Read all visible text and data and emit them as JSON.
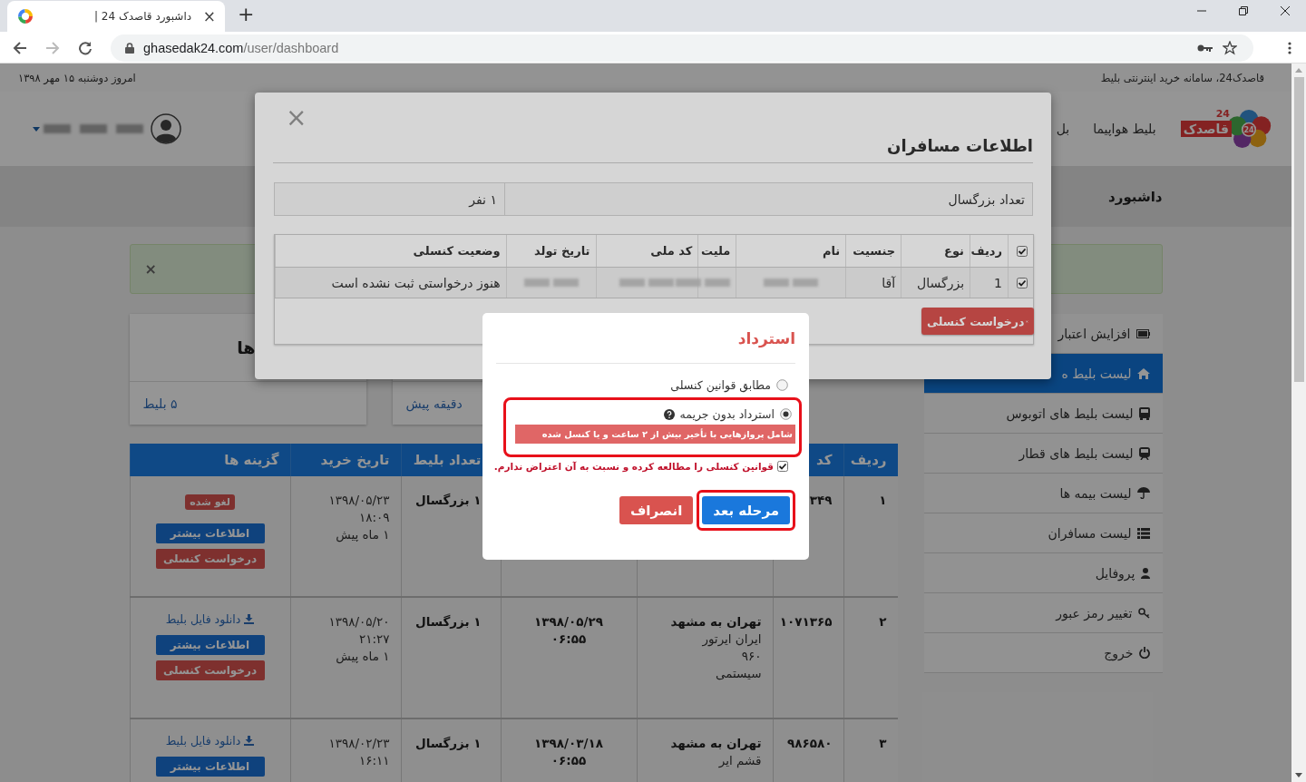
{
  "browser": {
    "tab": {
      "title": "داشبورد قاصدک 24 |",
      "close": "×"
    },
    "new_tab": "+",
    "address": {
      "host": "ghasedak24.com",
      "path": "/user/dashboard"
    }
  },
  "top_bar": {
    "tagline": "قاصدک24، سامانه خرید اینترنتی بلیط",
    "date": "امروز دوشنبه ۱۵ مهر ۱۳۹۸"
  },
  "header": {
    "logo": {
      "emblem": "24",
      "wordmark": "قاصدک",
      "badge": "24"
    },
    "nav": [
      {
        "label": "بلیط هواپیما"
      },
      {
        "label": "بل"
      }
    ]
  },
  "page_title": "داشبورد",
  "alert": {
    "close": "×"
  },
  "sidebar": {
    "items": [
      {
        "label": "افزایش اعتبار",
        "kind": "card",
        "selected": false
      },
      {
        "label": "لیست بلیط ه",
        "kind": "home",
        "selected": true
      },
      {
        "label": "لیست بلیط های اتوبوس",
        "kind": "bus",
        "selected": false
      },
      {
        "label": "لیست بلیط های قطار",
        "kind": "train",
        "selected": false
      },
      {
        "label": "لیست بیمه ها",
        "kind": "umbrella",
        "selected": false
      },
      {
        "label": "لیست مسافران",
        "kind": "list",
        "selected": false
      },
      {
        "label": "پروفایل",
        "kind": "user",
        "selected": false
      },
      {
        "label": "تغییر رمز عبور",
        "kind": "key",
        "selected": false
      },
      {
        "label": "خروج",
        "kind": "power",
        "selected": false
      }
    ]
  },
  "stat_cards": [
    {
      "link": "دقیقه پیش"
    },
    {
      "title": "ها",
      "link": "۵ بلیط"
    }
  ],
  "tickets_table": {
    "columns": [
      {
        "label": "ردیف"
      },
      {
        "label": "کد"
      },
      {},
      {},
      {
        "label": "تعداد بلیط"
      },
      {
        "label": "تاریخ خرید"
      },
      {
        "label": "گزینه ها"
      }
    ],
    "rows": [
      {
        "index": "۱",
        "code": "۳۴۹",
        "route": [],
        "departure": [],
        "count": "۱ بزرگسال",
        "purchase": [
          "۱۳۹۸/۰۵/۲۳",
          "۱۸:۰۹",
          "۱ ماه پیش"
        ],
        "options": [
          {
            "kind": "status",
            "label": "لغو شده"
          },
          {
            "kind": "info",
            "label": "اطلاعات بیشتر"
          },
          {
            "kind": "cancel",
            "label": "درخواست کنسلی"
          }
        ]
      },
      {
        "index": "۲",
        "code": "۱۰۷۱۳۶۵",
        "route": [
          "تهران به مشهد",
          "ایران ایرتور",
          "۹۶۰",
          "سیستمی"
        ],
        "departure": [
          "۱۳۹۸/۰۵/۲۹",
          "۰۶:۵۵"
        ],
        "count": "۱ بزرگسال",
        "purchase": [
          "۱۳۹۸/۰۵/۲۰",
          "۲۱:۲۷",
          "۱ ماه پیش"
        ],
        "options": [
          {
            "kind": "download",
            "label": "دانلود فایل بلیط"
          },
          {
            "kind": "info",
            "label": "اطلاعات بیشتر"
          },
          {
            "kind": "cancel",
            "label": "درخواست کنسلی"
          }
        ]
      },
      {
        "index": "۳",
        "code": "۹۸۶۵۸۰",
        "route": [
          "تهران به مشهد",
          "قشم ایر"
        ],
        "departure": [
          "۱۳۹۸/۰۳/۱۸",
          "۰۶:۵۵"
        ],
        "count": "۱ بزرگسال",
        "purchase": [
          "۱۳۹۸/۰۲/۲۳",
          "۱۶:۱۱"
        ],
        "options": [
          {
            "kind": "download",
            "label": "دانلود فایل بلیط"
          },
          {
            "kind": "info",
            "label": "اطلاعات بیشتر"
          }
        ]
      }
    ]
  },
  "passengers_modal": {
    "close": "×",
    "title": "اطلاعات مسافران",
    "summary": [
      {
        "label": "تعداد بزرگسال",
        "value": "۱ نفر"
      }
    ],
    "table": {
      "select_all": {
        "checked": true
      },
      "columns": [
        "ردیف",
        "نوع",
        "جنسیت",
        "نام",
        "ملیت",
        "کد ملی",
        "تاریخ تولد",
        "وضعیت کنسلی"
      ],
      "rows": [
        {
          "checked": true,
          "cells": [
            {
              "text": "1"
            },
            {
              "text": "بزرگسال"
            },
            {
              "text": "آقا"
            },
            {
              "kind": "redacted"
            },
            {
              "kind": "redacted"
            },
            {
              "kind": "redacted"
            },
            {
              "kind": "redacted"
            },
            {
              "text": "هنوز درخواستی ثبت نشده است"
            }
          ]
        }
      ]
    },
    "cancel_button": {
      "label": "درخواست کنسلی"
    }
  },
  "refund_dialog": {
    "title": "استرداد",
    "options": [
      {
        "label": "مطابق قوانین کنسلی",
        "selected": false,
        "help": false,
        "highlighted": false
      },
      {
        "label": "استرداد بدون جریمه",
        "selected": true,
        "help": true,
        "note": "شامل پروازهایی با تأخیر بیش از ۲ ساعت و یا کنسل شده",
        "highlighted": true
      }
    ],
    "agree": {
      "checked": true,
      "label": "قوانین کنسلی را مطالعه کرده و نسبت به آن اعتراض ندارم."
    },
    "buttons": [
      {
        "label": "مرحله بعد",
        "kind": "primary",
        "highlighted": true
      },
      {
        "label": "انصراف",
        "kind": "danger",
        "highlighted": false
      }
    ]
  }
}
